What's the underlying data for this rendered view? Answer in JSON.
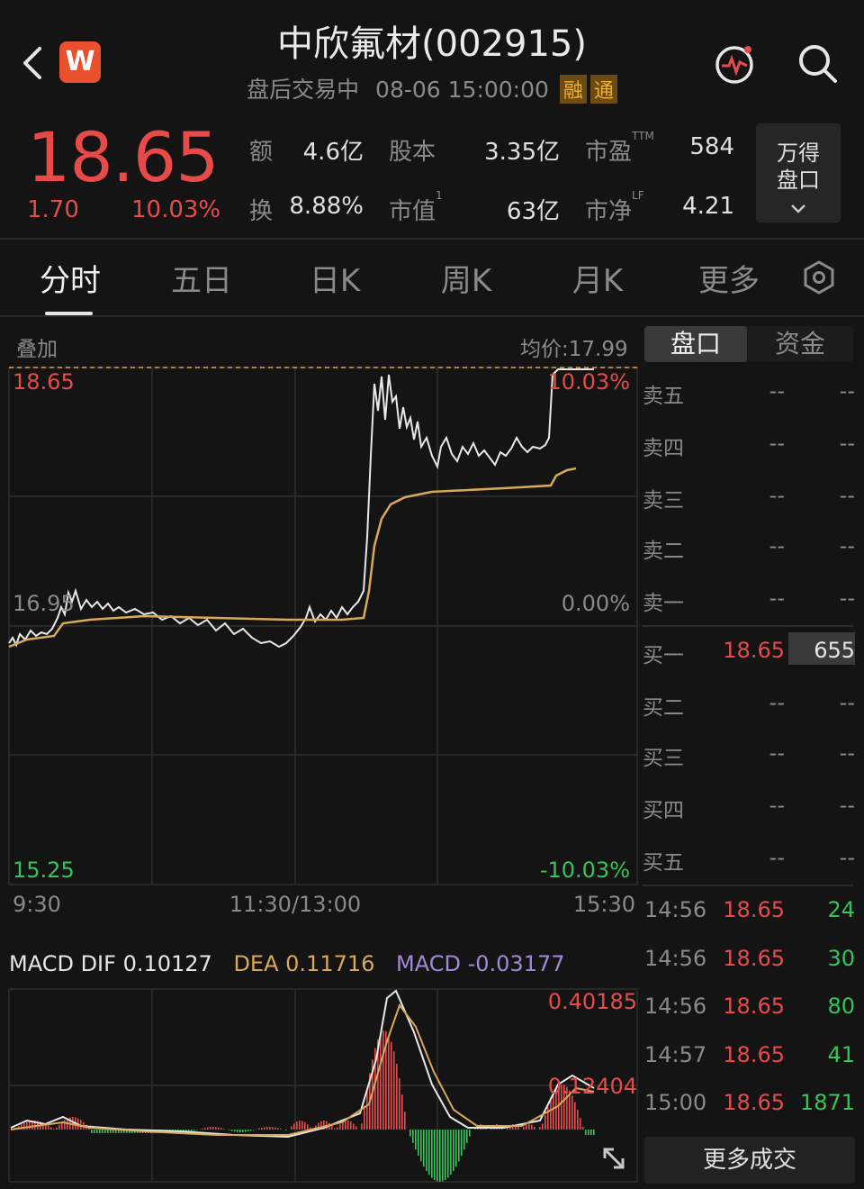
{
  "header": {
    "logo_letter": "W",
    "title": "中欣氟材(002915)",
    "status": "盘后交易中",
    "datetime": "08-06 15:00:00",
    "tag_margin": "融",
    "tag_connect": "通"
  },
  "quote": {
    "price": "18.65",
    "change": "1.70",
    "change_pct": "10.03%",
    "amount_label": "额",
    "amount": "4.6亿",
    "shares_label": "股本",
    "shares": "3.35亿",
    "pe_label": "市盈",
    "pe_sup": "TTM",
    "pe": "584",
    "turnover_label": "换",
    "turnover": "8.88%",
    "mcap_label": "市值",
    "mcap_sup": "1",
    "mcap": "63亿",
    "pb_label": "市净",
    "pb_sup": "LF",
    "pb": "4.21",
    "wind_line1": "万得",
    "wind_line2": "盘口"
  },
  "tabs": [
    {
      "label": "分时",
      "active": true
    },
    {
      "label": "五日",
      "active": false
    },
    {
      "label": "日K",
      "active": false
    },
    {
      "label": "周K",
      "active": false
    },
    {
      "label": "月K",
      "active": false
    },
    {
      "label": "更多",
      "active": false
    }
  ],
  "intraday": {
    "overlay_label": "叠加",
    "avg_price_label": "均价:17.99",
    "high_price": "18.65",
    "high_pct": "10.03%",
    "mid_price": "16.95",
    "mid_pct": "0.00%",
    "low_price": "15.25",
    "low_pct": "-10.03%",
    "time_start": "9:30",
    "time_mid": "11:30/13:00",
    "time_end": "15:30"
  },
  "macd": {
    "dif_label": "MACD DIF 0.10127",
    "dea_label": "DEA 0.11716",
    "macd_label": "MACD -0.03177",
    "max_label": "0.40185",
    "mid_label": "0.12404"
  },
  "colors": {
    "up": "#e84a4a",
    "down": "#35c45a",
    "avg_line": "#d9a85a",
    "price_line": "#e8e8e8",
    "macd_purple": "#a08ad8"
  },
  "orderbook": {
    "tab_book": "盘口",
    "tab_funds": "资金",
    "asks": [
      {
        "label": "卖五",
        "price": "--",
        "vol": "--"
      },
      {
        "label": "卖四",
        "price": "--",
        "vol": "--"
      },
      {
        "label": "卖三",
        "price": "--",
        "vol": "--"
      },
      {
        "label": "卖二",
        "price": "--",
        "vol": "--"
      },
      {
        "label": "卖一",
        "price": "--",
        "vol": "--"
      }
    ],
    "bids": [
      {
        "label": "买一",
        "price": "18.65",
        "vol": "655"
      },
      {
        "label": "买二",
        "price": "--",
        "vol": "--"
      },
      {
        "label": "买三",
        "price": "--",
        "vol": "--"
      },
      {
        "label": "买四",
        "price": "--",
        "vol": "--"
      },
      {
        "label": "买五",
        "price": "--",
        "vol": "--"
      }
    ]
  },
  "trades": [
    {
      "time": "14:56",
      "price": "18.65",
      "vol": "24"
    },
    {
      "time": "14:56",
      "price": "18.65",
      "vol": "30"
    },
    {
      "time": "14:56",
      "price": "18.65",
      "vol": "80"
    },
    {
      "time": "14:57",
      "price": "18.65",
      "vol": "41"
    },
    {
      "time": "15:00",
      "price": "18.65",
      "vol": "1871"
    }
  ],
  "more_trades_label": "更多成交"
}
